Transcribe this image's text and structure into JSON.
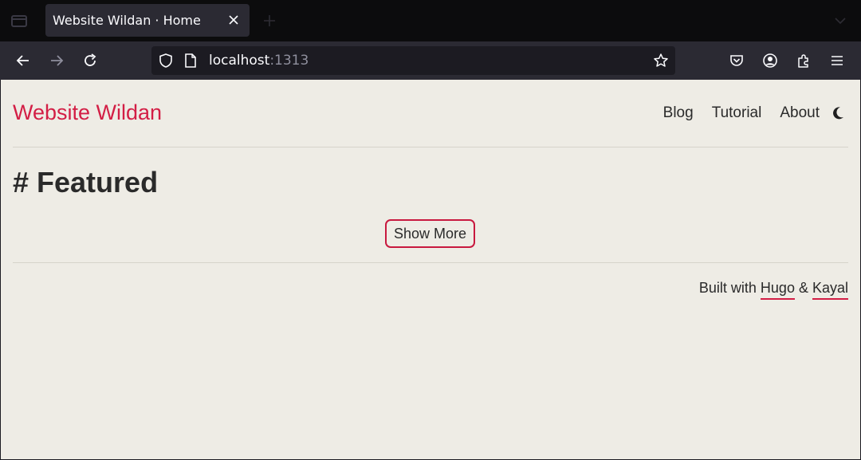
{
  "browser": {
    "tab_title": "Website Wildan · Home",
    "url_host": "localhost",
    "url_port": ":1313"
  },
  "site": {
    "title": "Website Wildan",
    "accent": "#d31e45",
    "menu": [
      {
        "label": "Blog"
      },
      {
        "label": "Tutorial"
      },
      {
        "label": "About"
      }
    ],
    "theme_toggle_icon": "moon-icon"
  },
  "main": {
    "heading": "# Featured",
    "show_more_label": "Show More"
  },
  "footer": {
    "prefix": "Built with ",
    "link1": "Hugo",
    "separator": " & ",
    "link2": "Kayal"
  }
}
